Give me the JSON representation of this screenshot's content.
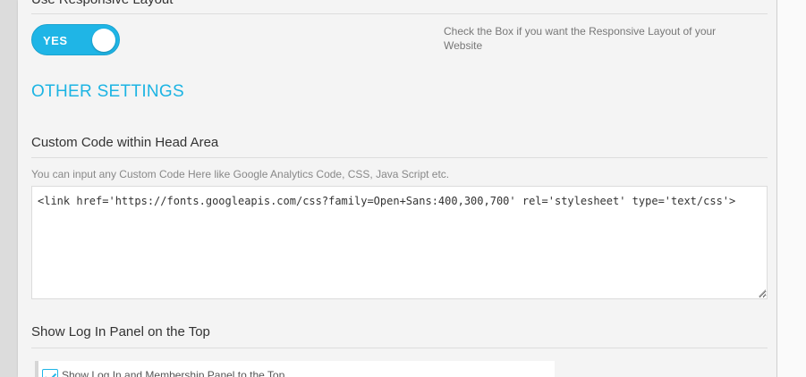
{
  "responsive": {
    "title": "Use Responsive Layout",
    "toggle_label": "YES",
    "help": "Check the Box if you want the Responsive Layout of your Website"
  },
  "other_settings": {
    "heading": "OTHER SETTINGS"
  },
  "custom_code": {
    "title": "Custom Code within Head Area",
    "description": "You can input any Custom Code Here like Google Analytics Code, CSS, Java Script etc.",
    "value": "<link href='https://fonts.googleapis.com/css?family=Open+Sans:400,300,700' rel='stylesheet' type='text/css'>"
  },
  "login_panel": {
    "title": "Show Log In Panel on the Top",
    "checkbox_label": "Show Log In and Membership Panel to the Top",
    "checked": true
  },
  "colors": {
    "accent": "#1fb5e6",
    "panel_bg": "#f4f4f4",
    "text": "#333333"
  }
}
